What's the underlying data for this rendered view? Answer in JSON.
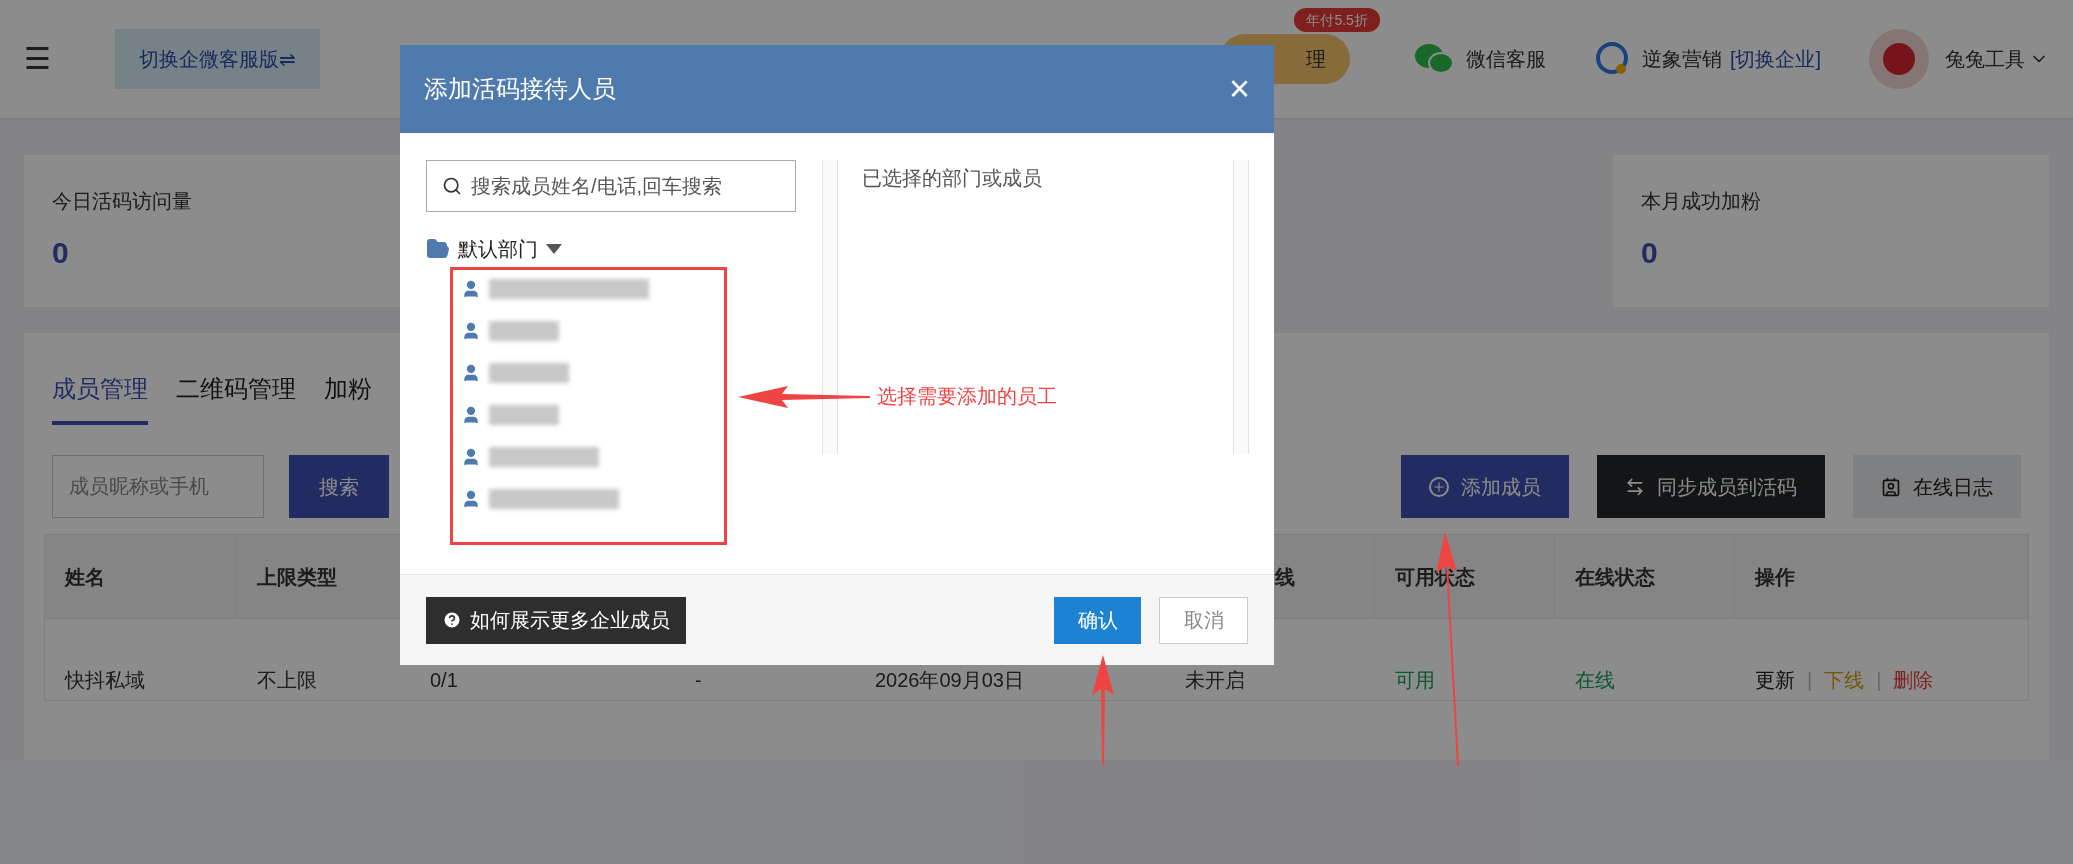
{
  "header": {
    "menu_icon": "☰",
    "switch_button": "切换企微客服版⇌",
    "promo_button": "理",
    "promo_badge": "年付5.5折",
    "wechat_service": "微信客服",
    "brand": "逆象营销",
    "switch_company": "[切换企业]",
    "user_name": "兔兔工具"
  },
  "stats": [
    {
      "label": "今日活码访问量",
      "value": "0"
    },
    {
      "label": "本月成功加粉",
      "value": "0"
    }
  ],
  "tabs": [
    {
      "label": "成员管理",
      "selected": true
    },
    {
      "label": "二维码管理",
      "selected": false
    },
    {
      "label": "加粉",
      "selected": false
    }
  ],
  "search": {
    "placeholder": "成员昵称或手机",
    "button": "搜索"
  },
  "actions": [
    {
      "label": "添加成员",
      "kind": "add"
    },
    {
      "label": "同步成员到活码",
      "kind": "sync"
    },
    {
      "label": "在线日志",
      "kind": "log"
    }
  ],
  "table": {
    "columns": [
      {
        "label": "姓名"
      },
      {
        "label": "上限类型"
      },
      {},
      {},
      {},
      {
        "label": "线"
      },
      {
        "label": "可用状态"
      },
      {
        "label": "在线状态"
      },
      {
        "label": "操作"
      }
    ],
    "rows": [
      {
        "cells": [
          "快抖私域",
          "不上限",
          "0/1",
          "-",
          "2026年09月03日",
          "未开启",
          "可用",
          "在线"
        ],
        "separator": "|",
        "ops": [
          {
            "label": "更新",
            "kind": "plain"
          },
          {
            "label": "下线",
            "kind": "warn"
          },
          {
            "label": "删除",
            "kind": "danger"
          }
        ]
      }
    ]
  },
  "modal": {
    "title": "添加活码接待人员",
    "close": "×",
    "search_placeholder": "搜索成员姓名/电话,回车搜索",
    "department": {
      "label": "默认部门",
      "expanded": true,
      "members": [
        {
          "kind": "blurred"
        },
        {
          "kind": "blurred"
        },
        {
          "kind": "blurred"
        },
        {
          "kind": "blurred"
        },
        {
          "kind": "blurred"
        },
        {
          "kind": "blurred"
        }
      ]
    },
    "selected_title": "已选择的部门或成员",
    "help_button": "如何展示更多企业成员",
    "confirm": "确认",
    "cancel": "取消"
  },
  "annotation": "选择需要添加的员工"
}
